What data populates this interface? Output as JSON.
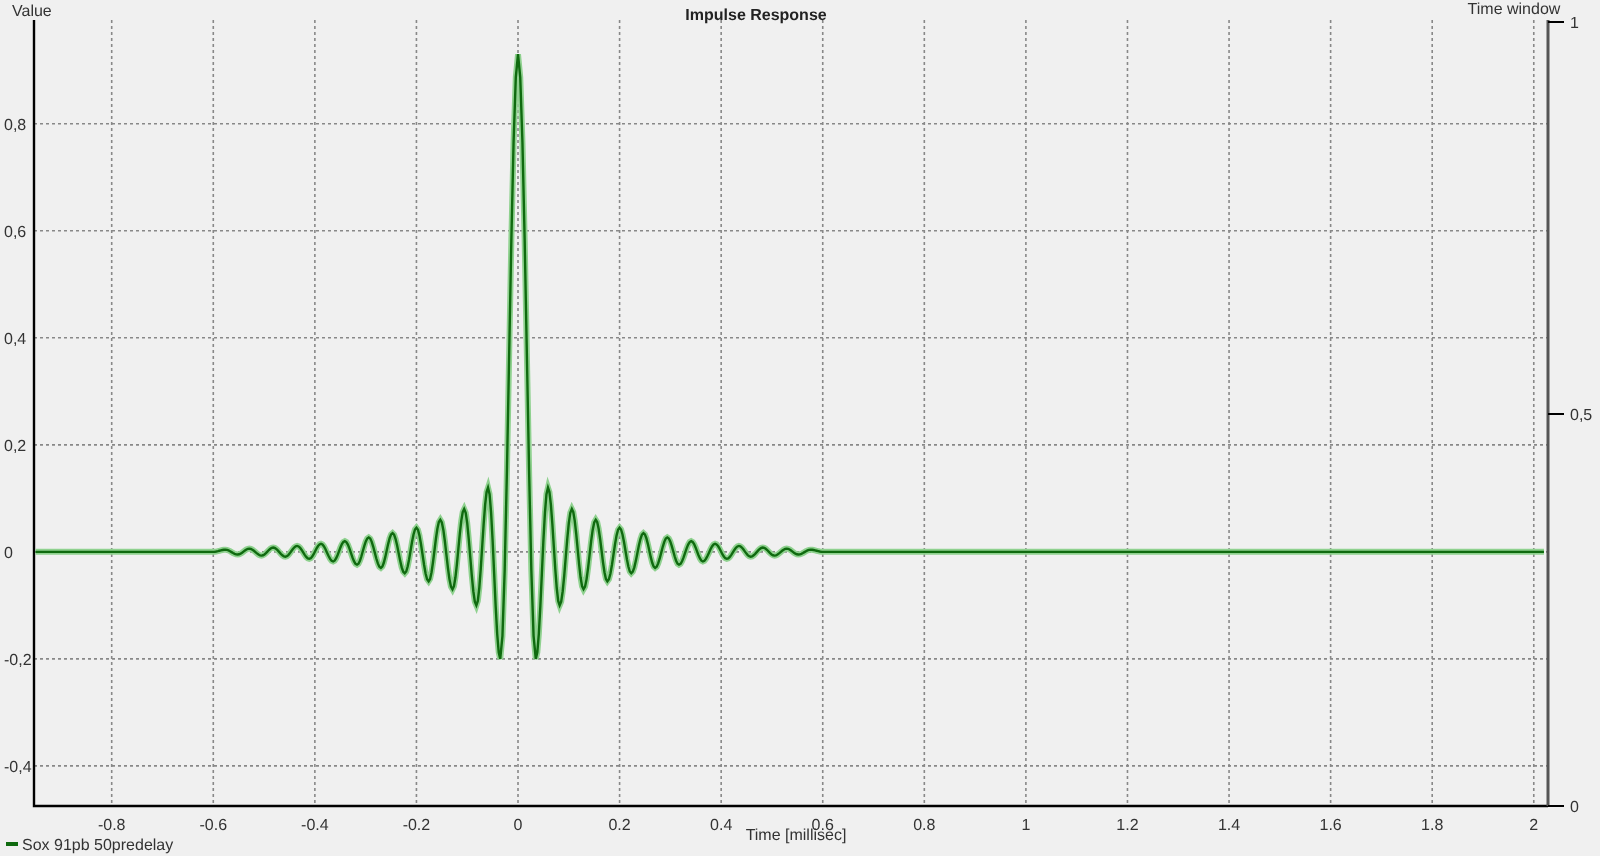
{
  "chart": {
    "chart_data": {
      "type": "line",
      "title": "Impulse Response",
      "xlabel": "Time [millisec]",
      "ylabel": "Value",
      "grid": true,
      "xlim": [
        -0.953,
        2.028
      ],
      "ylim": [
        -0.475,
        0.994
      ],
      "xticks": [
        -0.8,
        -0.6,
        -0.4,
        -0.2,
        0,
        0.2,
        0.4,
        0.6,
        0.8,
        1,
        1.2,
        1.4,
        1.6,
        1.8,
        2
      ],
      "yticks": [
        {
          "value": -0.4,
          "label": "-0,4"
        },
        {
          "value": -0.2,
          "label": "-0,2"
        },
        {
          "value": 0,
          "label": "0"
        },
        {
          "value": 0.2,
          "label": "0,2"
        },
        {
          "value": 0.4,
          "label": "0,4"
        },
        {
          "value": 0.6,
          "label": "0,6"
        },
        {
          "value": 0.8,
          "label": "0,8"
        }
      ],
      "x": [
        -0.95,
        -0.6,
        -0.576,
        -0.552,
        -0.529,
        -0.505,
        -0.482,
        -0.458,
        -0.435,
        -0.411,
        -0.388,
        -0.364,
        -0.341,
        -0.317,
        -0.294,
        -0.27,
        -0.247,
        -0.223,
        -0.2,
        -0.176,
        -0.153,
        -0.129,
        -0.106,
        -0.082,
        -0.059,
        -0.035,
        0,
        0.035,
        0.059,
        0.082,
        0.106,
        0.129,
        0.153,
        0.176,
        0.2,
        0.223,
        0.247,
        0.27,
        0.294,
        0.317,
        0.341,
        0.364,
        0.388,
        0.411,
        0.435,
        0.458,
        0.482,
        0.505,
        0.529,
        0.552,
        0.576,
        0.6,
        2.02
      ],
      "series": [
        {
          "name": "Sox 91pb 50predelay",
          "color": "#0f6a0f",
          "values": [
            0,
            0,
            0.004,
            -0.005,
            0.006,
            -0.007,
            0.008,
            -0.009,
            0.011,
            -0.013,
            0.015,
            -0.018,
            0.02,
            -0.024,
            0.027,
            -0.03,
            0.035,
            -0.04,
            0.045,
            -0.055,
            0.06,
            -0.07,
            0.08,
            -0.1,
            0.12,
            -0.2,
            0.93,
            -0.2,
            0.12,
            -0.1,
            0.08,
            -0.07,
            0.06,
            -0.055,
            0.045,
            -0.04,
            0.035,
            -0.03,
            0.027,
            -0.024,
            0.02,
            -0.018,
            0.015,
            -0.013,
            0.011,
            -0.009,
            0.008,
            -0.007,
            0.006,
            -0.005,
            0.004,
            0,
            0
          ]
        }
      ]
    },
    "secondary_axis": {
      "label": "Time window",
      "ticks": [
        "1",
        "0,5",
        "0"
      ]
    }
  }
}
